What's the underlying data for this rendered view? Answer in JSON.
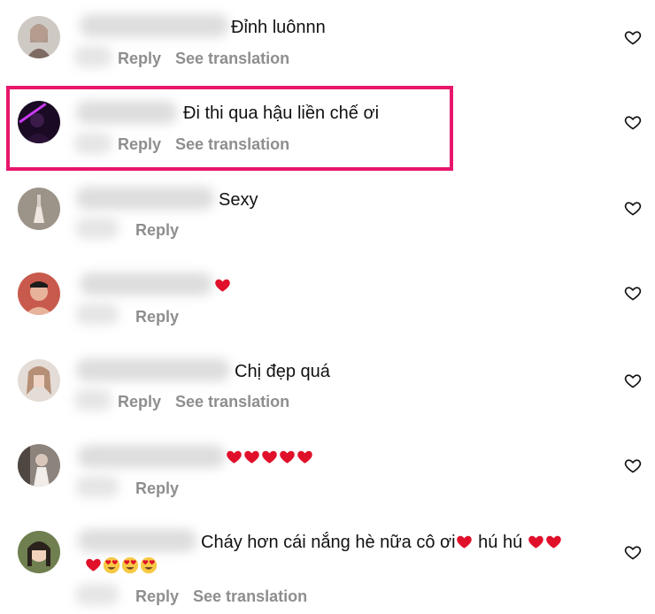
{
  "comments": [
    {
      "text": "Đỉnh luônnn",
      "reply": "Reply",
      "translate": "See translation"
    },
    {
      "text": "Đi thi qua hậu liền chế ơi",
      "reply": "Reply",
      "translate": "See translation"
    },
    {
      "text": "Sexy",
      "reply": "Reply"
    },
    {
      "text": "",
      "reply": "Reply"
    },
    {
      "text": "Chị đẹp quá",
      "reply": "Reply",
      "translate": "See translation"
    },
    {
      "text": "",
      "reply": "Reply"
    },
    {
      "text": "Cháy hơn cái nắng hè nữa cô ơi",
      "text_b": "hú hú",
      "reply": "Reply",
      "translate": "See translation"
    }
  ],
  "icons": {
    "like": "heart-outline-icon",
    "emoji_heart": "red-heart-emoji",
    "emoji_face": "heart-eyes-emoji"
  },
  "colors": {
    "highlight": "#e8176c",
    "action_text": "#8e8e8e",
    "heart_red": "#e0102a"
  }
}
